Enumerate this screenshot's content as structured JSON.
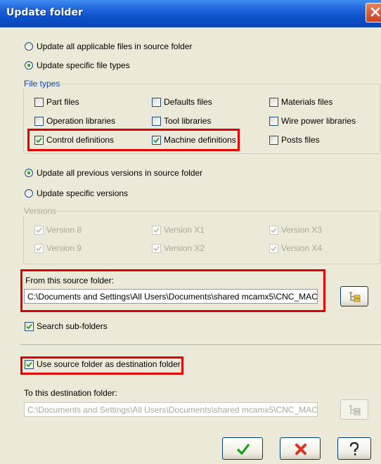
{
  "window": {
    "title": "Update folder"
  },
  "update_scope": {
    "option_all_files": "Update all applicable files in source folder",
    "option_specific_types": "Update specific file types",
    "selected": "specific_types"
  },
  "file_types": {
    "legend": "File types",
    "items": [
      {
        "label": "Part files",
        "checked": false
      },
      {
        "label": "Defaults files",
        "checked": false
      },
      {
        "label": "Materials files",
        "checked": false
      },
      {
        "label": "Operation libraries",
        "checked": false
      },
      {
        "label": "Tool libraries",
        "checked": false
      },
      {
        "label": "Wire power libraries",
        "checked": false
      },
      {
        "label": "Control definitions",
        "checked": true
      },
      {
        "label": "Machine definitions",
        "checked": true
      },
      {
        "label": "Posts files",
        "checked": false
      }
    ]
  },
  "version_scope": {
    "option_all_versions": "Update all previous versions in source folder",
    "option_specific_versions": "Update specific versions",
    "selected": "all_versions"
  },
  "versions": {
    "legend": "Versions",
    "items": [
      {
        "label": "Version 8",
        "checked": true
      },
      {
        "label": "Version X1",
        "checked": true
      },
      {
        "label": "Version X3",
        "checked": true
      },
      {
        "label": "Version 9",
        "checked": true
      },
      {
        "label": "Version X2",
        "checked": true
      },
      {
        "label": "Version X4",
        "checked": true
      }
    ]
  },
  "source": {
    "label": "From this source folder:",
    "path": "C:\\Documents and Settings\\All Users\\Documents\\shared mcamx5\\CNC_MAC",
    "browse_icon": "folder-tree-icon"
  },
  "search_subfolders": {
    "label": "Search sub-folders",
    "checked": true
  },
  "use_source_as_dest": {
    "label": "Use source folder as destination folder",
    "checked": true
  },
  "destination": {
    "label": "To this destination folder:",
    "path": "C:\\Documents and Settings\\All Users\\Documents\\shared mcamx5\\CNC_MAC",
    "browse_icon": "folder-tree-icon"
  },
  "footer": {
    "ok_icon": "checkmark-icon",
    "cancel_icon": "x-icon",
    "help_icon": "question-icon"
  },
  "colors": {
    "title_bar": "#0b4fc7",
    "dialog_face": "#ece9d8",
    "highlight": "#e00000",
    "group_legend": "#0046d5",
    "check_green": "#21a121"
  }
}
